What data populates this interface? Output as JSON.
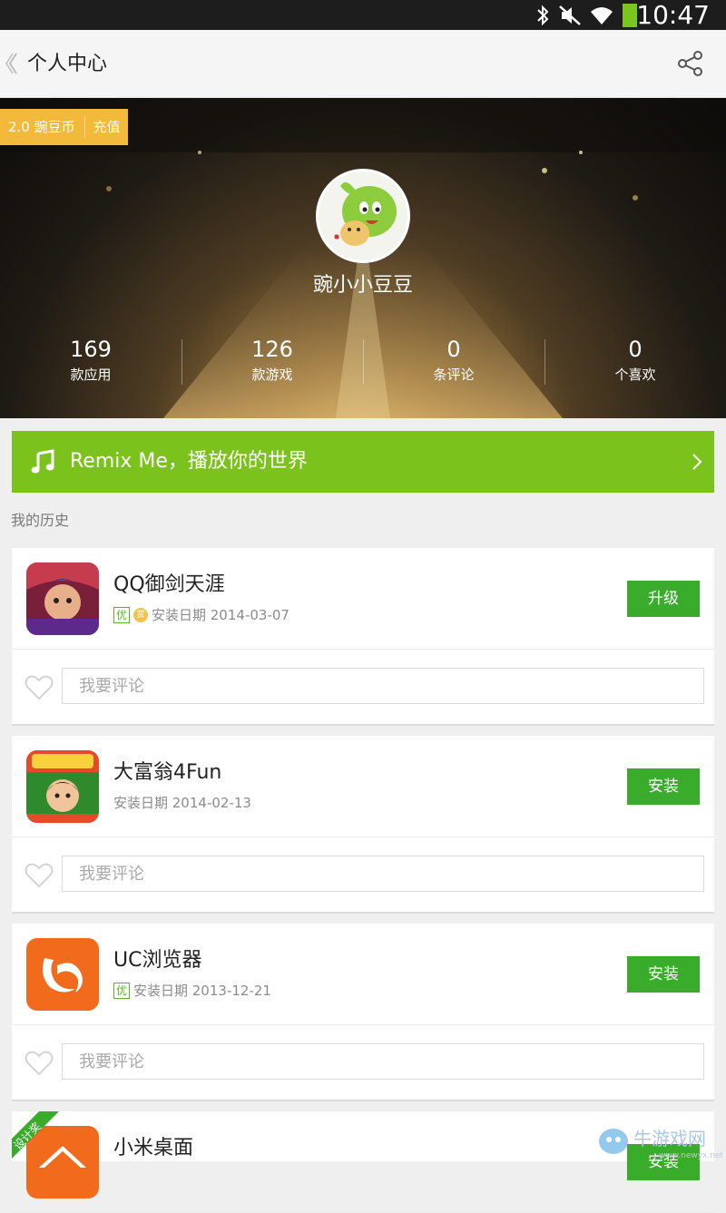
{
  "status_bar": {
    "time": "10:47",
    "icons": [
      "bluetooth-icon",
      "mute-icon",
      "wifi-icon",
      "battery-icon"
    ]
  },
  "app_bar": {
    "title": "个人中心",
    "back_icon": "back-icon",
    "share_icon": "share-icon"
  },
  "profile": {
    "coins": {
      "amount_label": "2.0 豌豆币",
      "topup_label": "充值"
    },
    "username": "豌小小豆豆",
    "stats": [
      {
        "value": "169",
        "label": "款应用"
      },
      {
        "value": "126",
        "label": "款游戏"
      },
      {
        "value": "0",
        "label": "条评论"
      },
      {
        "value": "0",
        "label": "个喜欢"
      }
    ]
  },
  "remix_banner": {
    "label": "Remix Me，播放你的世界",
    "color": "#7cc21c"
  },
  "history": {
    "title": "我的历史",
    "comment_placeholder": "我要评论",
    "items": [
      {
        "name": "QQ御剑天涯",
        "date": "安装日期 2014-03-07",
        "badge_you": "优",
        "badge_coin": "赏",
        "action": "升级"
      },
      {
        "name": "大富翁4Fun",
        "date": "安装日期 2014-02-13",
        "action": "安装"
      },
      {
        "name": "UC浏览器",
        "date": "安装日期 2013-12-21",
        "badge_you": "优",
        "action": "安装"
      },
      {
        "name": "小米桌面",
        "ribbon": "设计奖",
        "action": "安装"
      }
    ]
  },
  "watermark": {
    "text": "牛游戏网",
    "sub": "www.newyx.net"
  },
  "colors": {
    "accent_green": "#3aac2c",
    "banner_green": "#7cc21c",
    "coin_orange": "#f3b93a"
  }
}
